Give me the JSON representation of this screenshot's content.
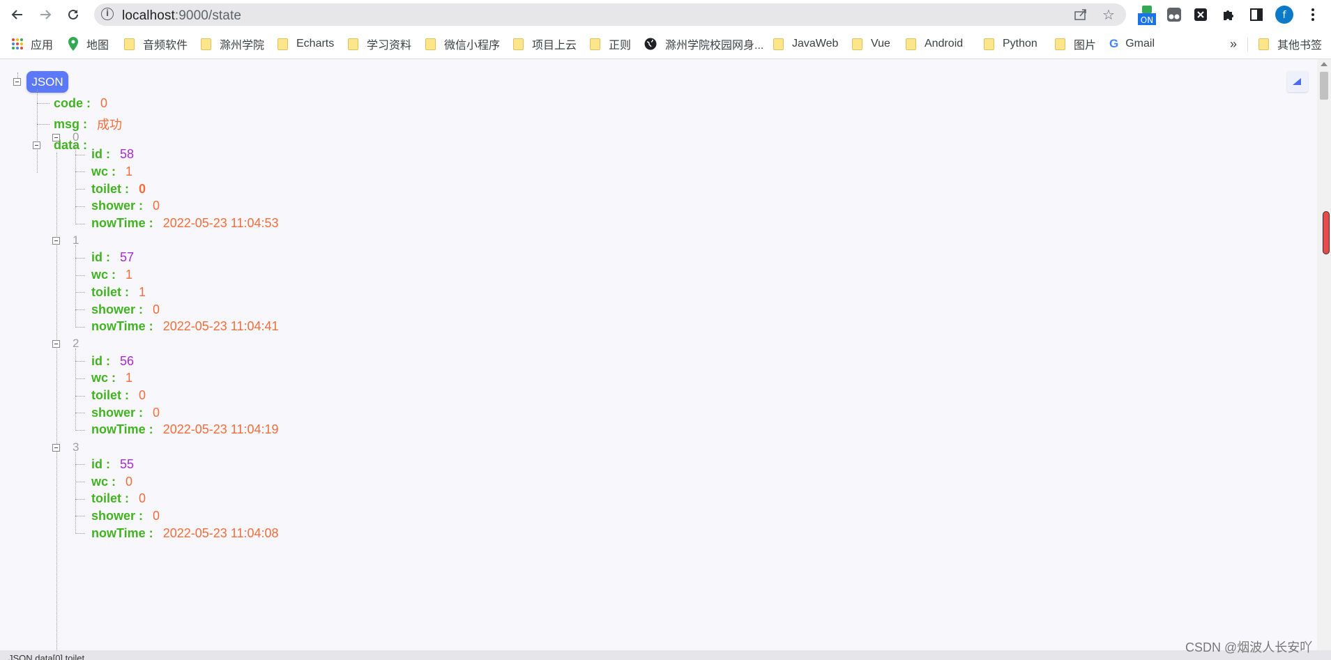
{
  "browser": {
    "url_host": "localhost",
    "url_path": ":9000/state",
    "profile_initial": "f",
    "ext_on_label": "ON"
  },
  "bookmarks": {
    "apps": "应用",
    "maps": "地图",
    "items": [
      "音频软件",
      "滁州学院",
      "Echarts",
      "学习资料",
      "微信小程序",
      "项目上云",
      "正则",
      "滁州学院校园网身...",
      "JavaWeb",
      "Vue",
      "Android",
      "Python",
      "图片"
    ],
    "gmail": "Gmail",
    "overflow": "»",
    "other": "其他书签"
  },
  "json": {
    "badge": "JSON",
    "code_key": "code :",
    "code_val": "0",
    "msg_key": "msg :",
    "msg_val": "成功",
    "data_key": "data :",
    "keys": {
      "id": "id :",
      "wc": "wc :",
      "toilet": "toilet :",
      "shower": "shower :",
      "nowTime": "nowTime :"
    },
    "records": [
      {
        "index": "0",
        "id": "58",
        "wc": "1",
        "toilet": "0",
        "shower": "0",
        "nowTime": "2022-05-23 11:04:53"
      },
      {
        "index": "1",
        "id": "57",
        "wc": "1",
        "toilet": "1",
        "shower": "0",
        "nowTime": "2022-05-23 11:04:41"
      },
      {
        "index": "2",
        "id": "56",
        "wc": "1",
        "toilet": "0",
        "shower": "0",
        "nowTime": "2022-05-23 11:04:19"
      },
      {
        "index": "3",
        "id": "55",
        "wc": "0",
        "toilet": "0",
        "shower": "0",
        "nowTime": "2022-05-23 11:04:08"
      }
    ]
  },
  "statusbar": "JSON.data[0].toilet",
  "watermark": "CSDN @烟波人长安吖",
  "colors": {
    "key": "#42b223",
    "value": "#f36c3a",
    "id": "#a828d8",
    "badge": "#5b78f7"
  }
}
